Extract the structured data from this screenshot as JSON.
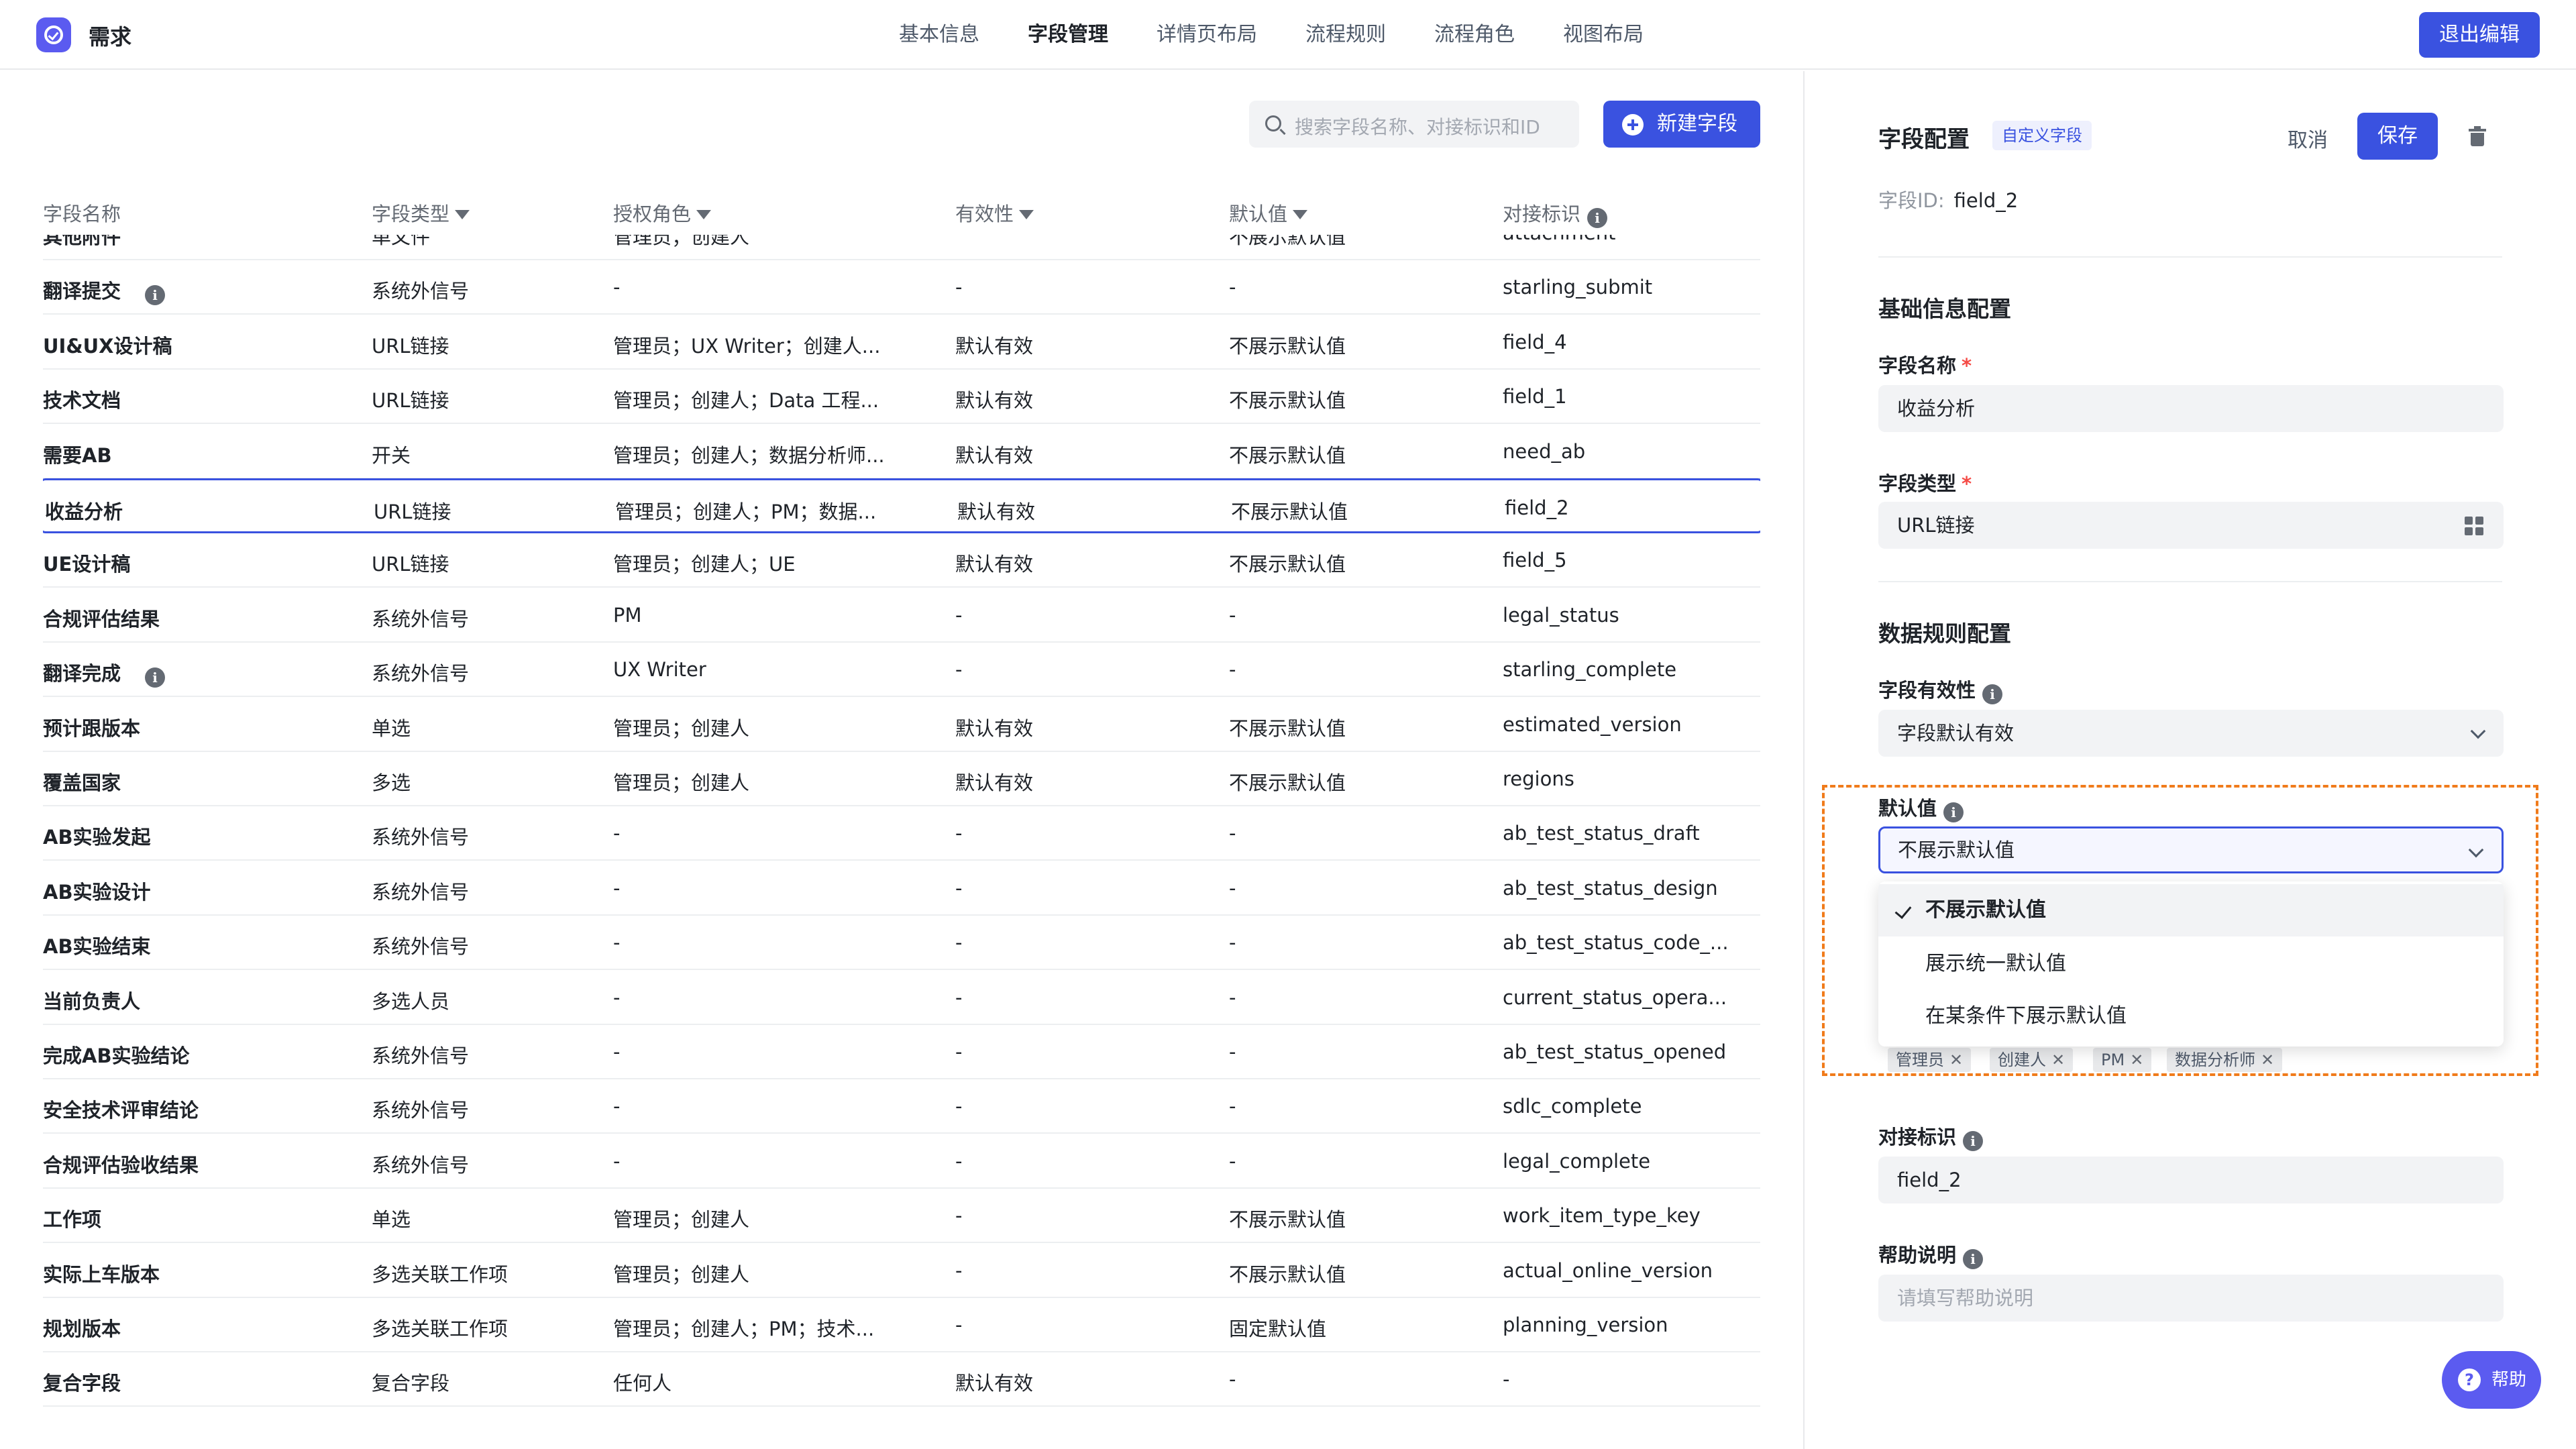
{
  "app": {
    "title": "需求"
  },
  "nav": {
    "tabs": [
      "基本信息",
      "字段管理",
      "详情页布局",
      "流程规则",
      "流程角色",
      "视图布局"
    ],
    "active_index": 1
  },
  "header": {
    "exit_label": "退出编辑"
  },
  "toolbar": {
    "search_placeholder": "搜索字段名称、对接标识和ID",
    "new_field_label": "新建字段"
  },
  "table": {
    "columns": [
      "字段名称",
      "字段类型",
      "授权角色",
      "有效性",
      "默认值",
      "对接标识"
    ],
    "rows": [
      {
        "name": "其他附件",
        "type": "单文件",
        "roles": "管理员；创建人",
        "validity": "-",
        "default": "不展示默认值",
        "key": "attachment"
      },
      {
        "name": "翻译提交",
        "info": true,
        "type": "系统外信号",
        "roles": "-",
        "validity": "-",
        "default": "-",
        "key": "starling_submit"
      },
      {
        "name": "UI&UX设计稿",
        "type": "URL链接",
        "roles": "管理员；UX Writer；创建人...",
        "validity": "默认有效",
        "default": "不展示默认值",
        "key": "field_4"
      },
      {
        "name": "技术文档",
        "type": "URL链接",
        "roles": "管理员；创建人；Data 工程...",
        "validity": "默认有效",
        "default": "不展示默认值",
        "key": "field_1"
      },
      {
        "name": "需要AB",
        "type": "开关",
        "roles": "管理员；创建人；数据分析师...",
        "validity": "默认有效",
        "default": "不展示默认值",
        "key": "need_ab"
      },
      {
        "name": "收益分析",
        "type": "URL链接",
        "roles": "管理员；创建人；PM；数据...",
        "validity": "默认有效",
        "default": "不展示默认值",
        "key": "field_2",
        "selected": true
      },
      {
        "name": "UE设计稿",
        "type": "URL链接",
        "roles": "管理员；创建人；UE",
        "validity": "默认有效",
        "default": "不展示默认值",
        "key": "field_5"
      },
      {
        "name": "合规评估结果",
        "type": "系统外信号",
        "roles": "PM",
        "validity": "-",
        "default": "-",
        "key": "legal_status"
      },
      {
        "name": "翻译完成",
        "info": true,
        "type": "系统外信号",
        "roles": "UX Writer",
        "validity": "-",
        "default": "-",
        "key": "starling_complete"
      },
      {
        "name": "预计跟版本",
        "type": "单选",
        "roles": "管理员；创建人",
        "validity": "默认有效",
        "default": "不展示默认值",
        "key": "estimated_version"
      },
      {
        "name": "覆盖国家",
        "type": "多选",
        "roles": "管理员；创建人",
        "validity": "默认有效",
        "default": "不展示默认值",
        "key": "regions"
      },
      {
        "name": "AB实验发起",
        "type": "系统外信号",
        "roles": "-",
        "validity": "-",
        "default": "-",
        "key": "ab_test_status_draft"
      },
      {
        "name": "AB实验设计",
        "type": "系统外信号",
        "roles": "-",
        "validity": "-",
        "default": "-",
        "key": "ab_test_status_design"
      },
      {
        "name": "AB实验结束",
        "type": "系统外信号",
        "roles": "-",
        "validity": "-",
        "default": "-",
        "key": "ab_test_status_code_..."
      },
      {
        "name": "当前负责人",
        "type": "多选人员",
        "roles": "-",
        "validity": "-",
        "default": "-",
        "key": "current_status_opera..."
      },
      {
        "name": "完成AB实验结论",
        "type": "系统外信号",
        "roles": "-",
        "validity": "-",
        "default": "-",
        "key": "ab_test_status_opened"
      },
      {
        "name": "安全技术评审结论",
        "type": "系统外信号",
        "roles": "-",
        "validity": "-",
        "default": "-",
        "key": "sdlc_complete"
      },
      {
        "name": "合规评估验收结果",
        "type": "系统外信号",
        "roles": "-",
        "validity": "-",
        "default": "-",
        "key": "legal_complete"
      },
      {
        "name": "工作项",
        "type": "单选",
        "roles": "管理员；创建人",
        "validity": "-",
        "default": "不展示默认值",
        "key": "work_item_type_key"
      },
      {
        "name": "实际上车版本",
        "type": "多选关联工作项",
        "roles": "管理员；创建人",
        "validity": "-",
        "default": "不展示默认值",
        "key": "actual_online_version"
      },
      {
        "name": "规划版本",
        "type": "多选关联工作项",
        "roles": "管理员；创建人；PM；技术...",
        "validity": "-",
        "default": "固定默认值",
        "key": "planning_version"
      },
      {
        "name": "复合字段",
        "expandable": true,
        "type": "复合字段",
        "roles": "任何人",
        "validity": "默认有效",
        "default": "-",
        "key": "-"
      }
    ]
  },
  "panel": {
    "title": "字段配置",
    "custom_tag": "自定义字段",
    "cancel_label": "取消",
    "save_label": "保存",
    "field_id_label": "字段ID:",
    "field_id_value": "field_2",
    "basic_section": "基础信息配置",
    "name_label": "字段名称",
    "name_value": "收益分析",
    "type_label": "字段类型",
    "type_value": "URL链接",
    "required_mark": "*",
    "rules_section": "数据规则配置",
    "validity_label": "字段有效性",
    "validity_value": "字段默认有效",
    "default_label": "默认值",
    "default_value": "不展示默认值",
    "default_options": [
      "不展示默认值",
      "展示统一默认值",
      "在某条件下展示默认值"
    ],
    "role_tags": [
      "管理员",
      "创建人",
      "PM",
      "数据分析师"
    ],
    "key_label": "对接标识",
    "key_value": "field_2",
    "help_label": "帮助说明",
    "help_placeholder": "请填写帮助说明"
  },
  "help_button_label": "帮助",
  "colors": {
    "primary": "#3a52e0",
    "logo": "#5b5bf0",
    "highlight": "#f07b1b",
    "required": "#f54a45"
  }
}
